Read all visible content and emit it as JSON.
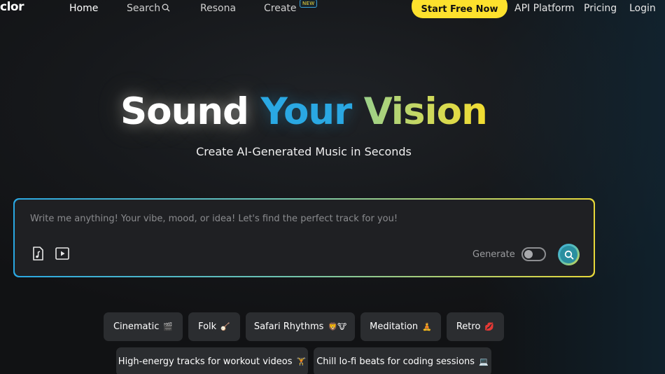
{
  "nav": {
    "logo": "clor",
    "home": "Home",
    "search": "Search",
    "resona": "Resona",
    "create": "Create",
    "new_badge": "NEW",
    "start_button": "Start Free Now",
    "api": "API Platform",
    "pricing": "Pricing",
    "login": "Login"
  },
  "hero": {
    "title_part1": "Sound",
    "title_part2": "Your",
    "title_part3": "Vision",
    "subtitle": "Create AI-Generated Music in Seconds"
  },
  "prompt": {
    "placeholder": "Write me anything! Your vibe, mood, or idea! Let's find the perfect track for you!",
    "generate_label": "Generate",
    "generate_enabled": false
  },
  "chips": [
    {
      "label": "Cinematic",
      "emoji": "🎬"
    },
    {
      "label": "Folk",
      "emoji": "🪕"
    },
    {
      "label": "Safari Rhythms",
      "emoji": "🦁🐮"
    },
    {
      "label": "Meditation",
      "emoji": "🧘"
    },
    {
      "label": "Retro",
      "emoji": "💋"
    },
    {
      "label": "High-energy tracks for workout videos",
      "emoji": "🏋"
    },
    {
      "label": "Chill lo-fi beats for coding sessions",
      "emoji": "💻"
    }
  ],
  "colors": {
    "accent_yellow": "#fde12d",
    "accent_blue": "#2aa8e3",
    "accent_green": "#9bd08a"
  }
}
